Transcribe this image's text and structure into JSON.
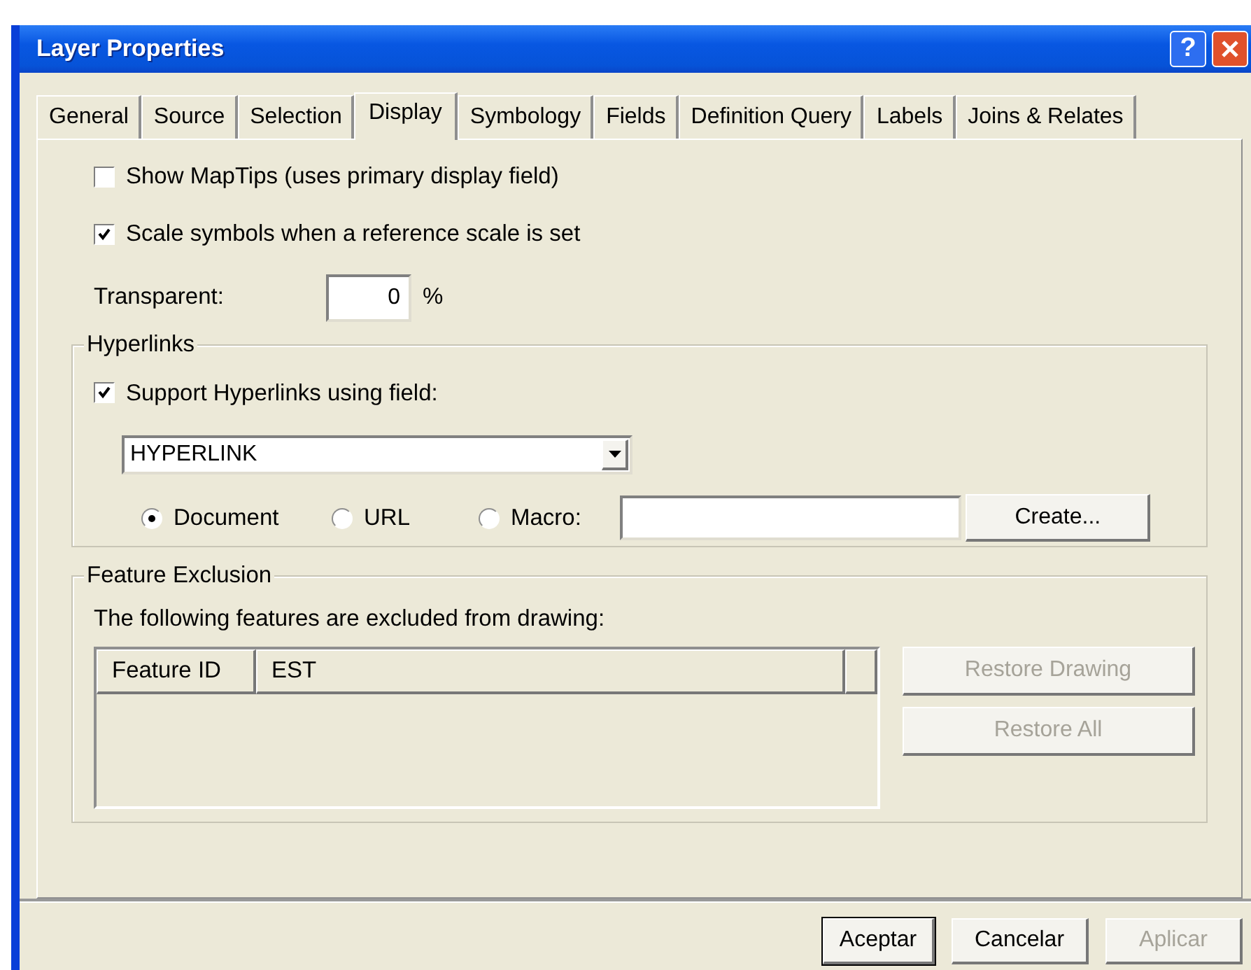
{
  "window": {
    "title": "Layer Properties",
    "help_label": "?"
  },
  "tabs": [
    {
      "label": "General",
      "selected": false
    },
    {
      "label": "Source",
      "selected": false
    },
    {
      "label": "Selection",
      "selected": false
    },
    {
      "label": "Display",
      "selected": true
    },
    {
      "label": "Symbology",
      "selected": false
    },
    {
      "label": "Fields",
      "selected": false
    },
    {
      "label": "Definition Query",
      "selected": false
    },
    {
      "label": "Labels",
      "selected": false
    },
    {
      "label": "Joins & Relates",
      "selected": false
    }
  ],
  "options": [
    {
      "label": "Show MapTips (uses primary display field)",
      "checked": false
    },
    {
      "label": "Scale symbols when a reference scale is set",
      "checked": true
    }
  ],
  "transparency": {
    "label": "Transparent:",
    "value": "0",
    "unit": "%"
  },
  "hyperlinks": {
    "title": "Hyperlinks",
    "support": {
      "label": "Support Hyperlinks using field:",
      "checked": true
    },
    "field": {
      "value": "HYPERLINK"
    },
    "types": [
      {
        "label": "Document",
        "selected": true
      },
      {
        "label": "URL",
        "selected": false
      },
      {
        "label": "Macro:",
        "selected": false
      }
    ],
    "create_button": {
      "label": "Create..."
    }
  },
  "feature_exclusion": {
    "title": "Feature Exclusion",
    "description": "The following features are excluded from drawing:",
    "columns": [
      "Feature ID",
      "EST"
    ],
    "buttons": [
      {
        "label": "Restore Drawing",
        "disabled": true
      },
      {
        "label": "Restore All",
        "disabled": true
      }
    ]
  },
  "buttons": [
    {
      "label": "Aceptar",
      "default": true,
      "disabled": false
    },
    {
      "label": "Cancelar",
      "default": false,
      "disabled": false
    },
    {
      "label": "Aplicar",
      "default": false,
      "disabled": true
    }
  ]
}
